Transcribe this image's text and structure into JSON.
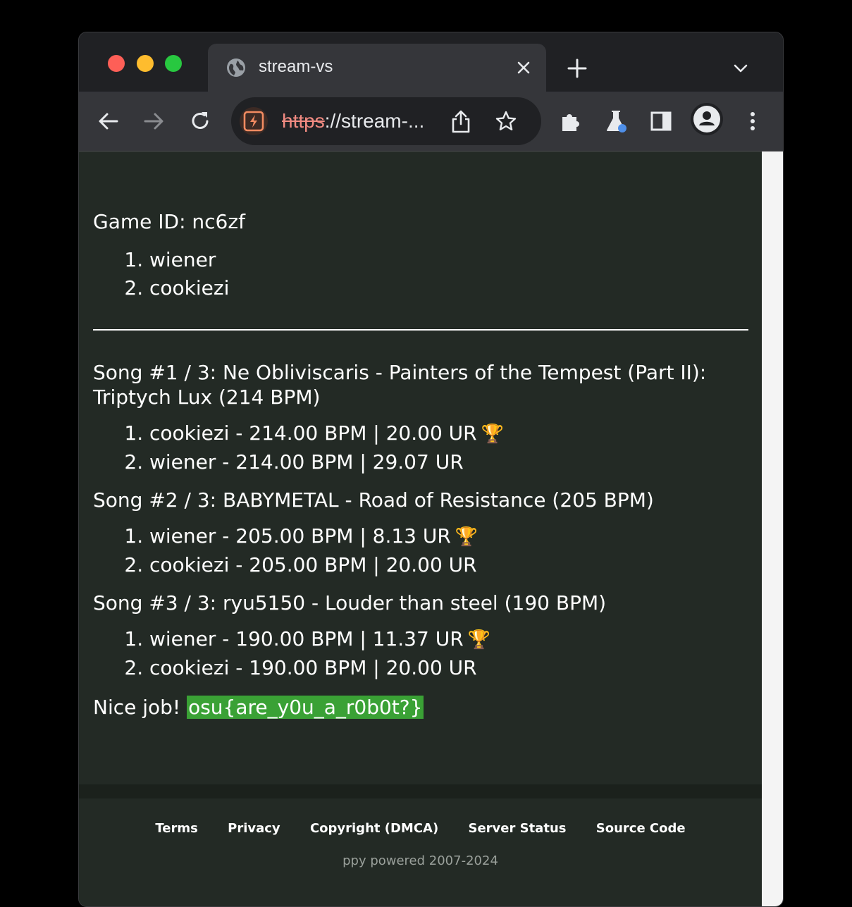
{
  "browser": {
    "tab_title": "stream-vs",
    "url_scheme": "https",
    "url_rest": "://stream-...",
    "accent_colors": {
      "close": "#fe5f57",
      "minimize": "#febc2e",
      "zoom": "#28c840"
    }
  },
  "page": {
    "game_id": "Game ID: nc6zf",
    "players": [
      "wiener",
      "cookiezi"
    ],
    "songs": [
      {
        "title": "Song #1 / 3: Ne Obliviscaris - Painters of the Tempest (Part II): Triptych Lux (214 BPM)",
        "results": [
          {
            "text": "cookiezi - 214.00 BPM | 20.00 UR",
            "trophy": "🏆"
          },
          {
            "text": "wiener - 214.00 BPM | 29.07 UR",
            "trophy": ""
          }
        ]
      },
      {
        "title": "Song #2 / 3: BABYMETAL - Road of Resistance (205 BPM)",
        "results": [
          {
            "text": "wiener - 205.00 BPM | 8.13 UR",
            "trophy": "🏆"
          },
          {
            "text": "cookiezi - 205.00 BPM | 20.00 UR",
            "trophy": ""
          }
        ]
      },
      {
        "title": "Song #3 / 3: ryu5150 - Louder than steel (190 BPM)",
        "results": [
          {
            "text": "wiener - 190.00 BPM | 11.37 UR",
            "trophy": "🏆"
          },
          {
            "text": "cookiezi - 190.00 BPM | 20.00 UR",
            "trophy": ""
          }
        ]
      }
    ],
    "nice_job": "Nice job!",
    "flag": "osu{are_y0u_a_r0b0t?}",
    "flag_color": "#3aa135"
  },
  "footer": {
    "links": [
      "Terms",
      "Privacy",
      "Copyright (DMCA)",
      "Server Status",
      "Source Code"
    ],
    "copyright": "ppy powered 2007-2024"
  }
}
